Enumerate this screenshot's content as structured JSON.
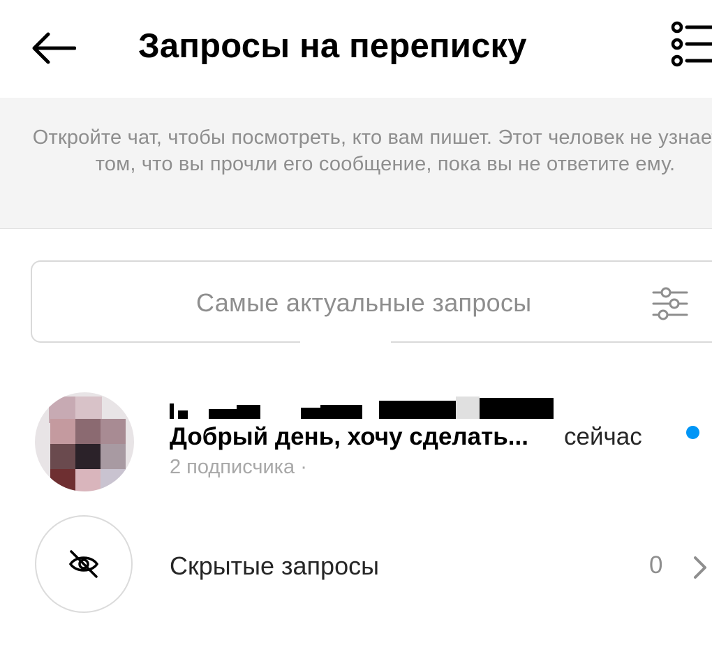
{
  "header": {
    "title": "Запросы на переписку",
    "back_icon": "arrow-left-icon",
    "menu_icon": "list-bullets-icon"
  },
  "banner": {
    "text": "Откройте чат, чтобы посмотреть, кто вам пишет. Этот человек не узнает о том, что вы прочли его сообщение, пока вы не ответите ему."
  },
  "filter": {
    "label": "Самые актуальные запросы",
    "icon": "sliders-icon"
  },
  "requests": [
    {
      "name": "",
      "message": "Добрый день, хочу сделать...",
      "time": "сейчас",
      "followers": "2 подписчика ·",
      "unread": true,
      "unread_color": "#0095f6"
    }
  ],
  "hidden_requests": {
    "label": "Скрытые запросы",
    "count": "0",
    "icon": "eye-off-icon",
    "chevron_icon": "chevron-right-icon"
  }
}
